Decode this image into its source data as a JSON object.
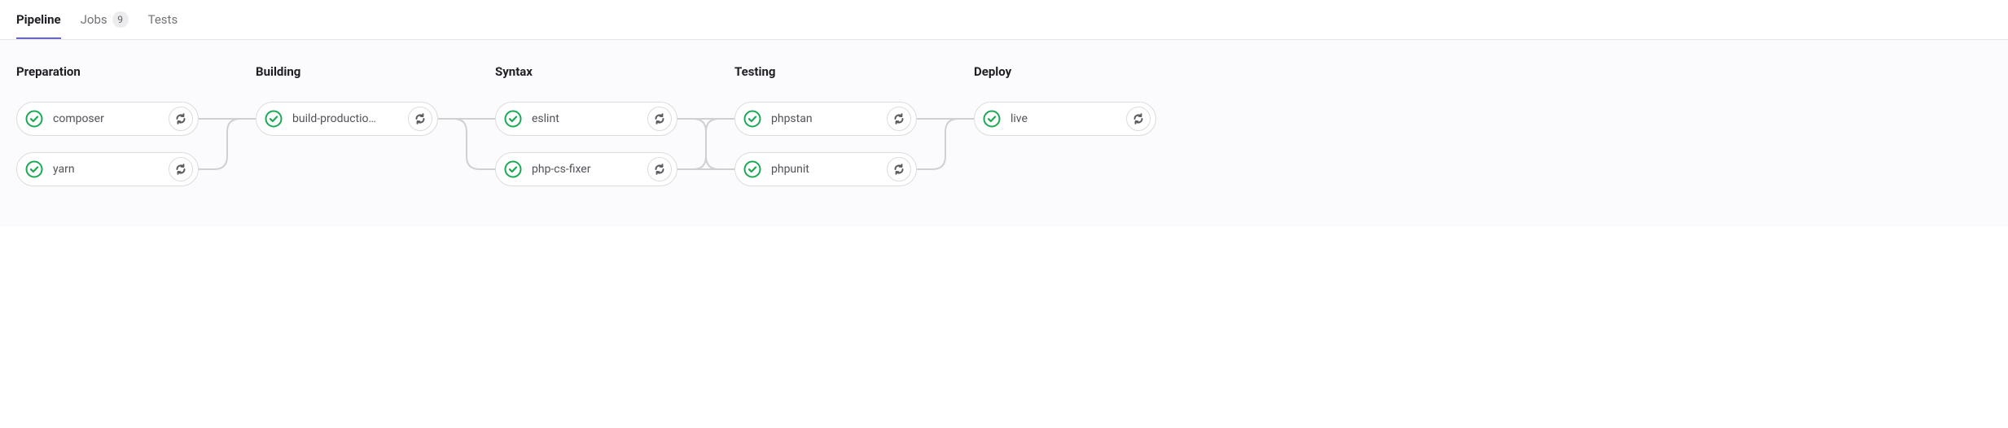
{
  "tabs": [
    {
      "label": "Pipeline",
      "active": true
    },
    {
      "label": "Jobs",
      "badge": "9",
      "active": false
    },
    {
      "label": "Tests",
      "active": false
    }
  ],
  "stages": [
    {
      "title": "Preparation",
      "jobs": [
        {
          "label": "composer",
          "status": "success"
        },
        {
          "label": "yarn",
          "status": "success"
        }
      ]
    },
    {
      "title": "Building",
      "jobs": [
        {
          "label": "build-productio…",
          "status": "success"
        }
      ]
    },
    {
      "title": "Syntax",
      "jobs": [
        {
          "label": "eslint",
          "status": "success"
        },
        {
          "label": "php-cs-fixer",
          "status": "success"
        }
      ]
    },
    {
      "title": "Testing",
      "jobs": [
        {
          "label": "phpstan",
          "status": "success"
        },
        {
          "label": "phpunit",
          "status": "success"
        }
      ]
    },
    {
      "title": "Deploy",
      "jobs": [
        {
          "label": "live",
          "status": "success"
        }
      ]
    }
  ],
  "colors": {
    "success": "#1aaa55",
    "connector": "#d0d0d4",
    "retry": "#5c5b61"
  }
}
